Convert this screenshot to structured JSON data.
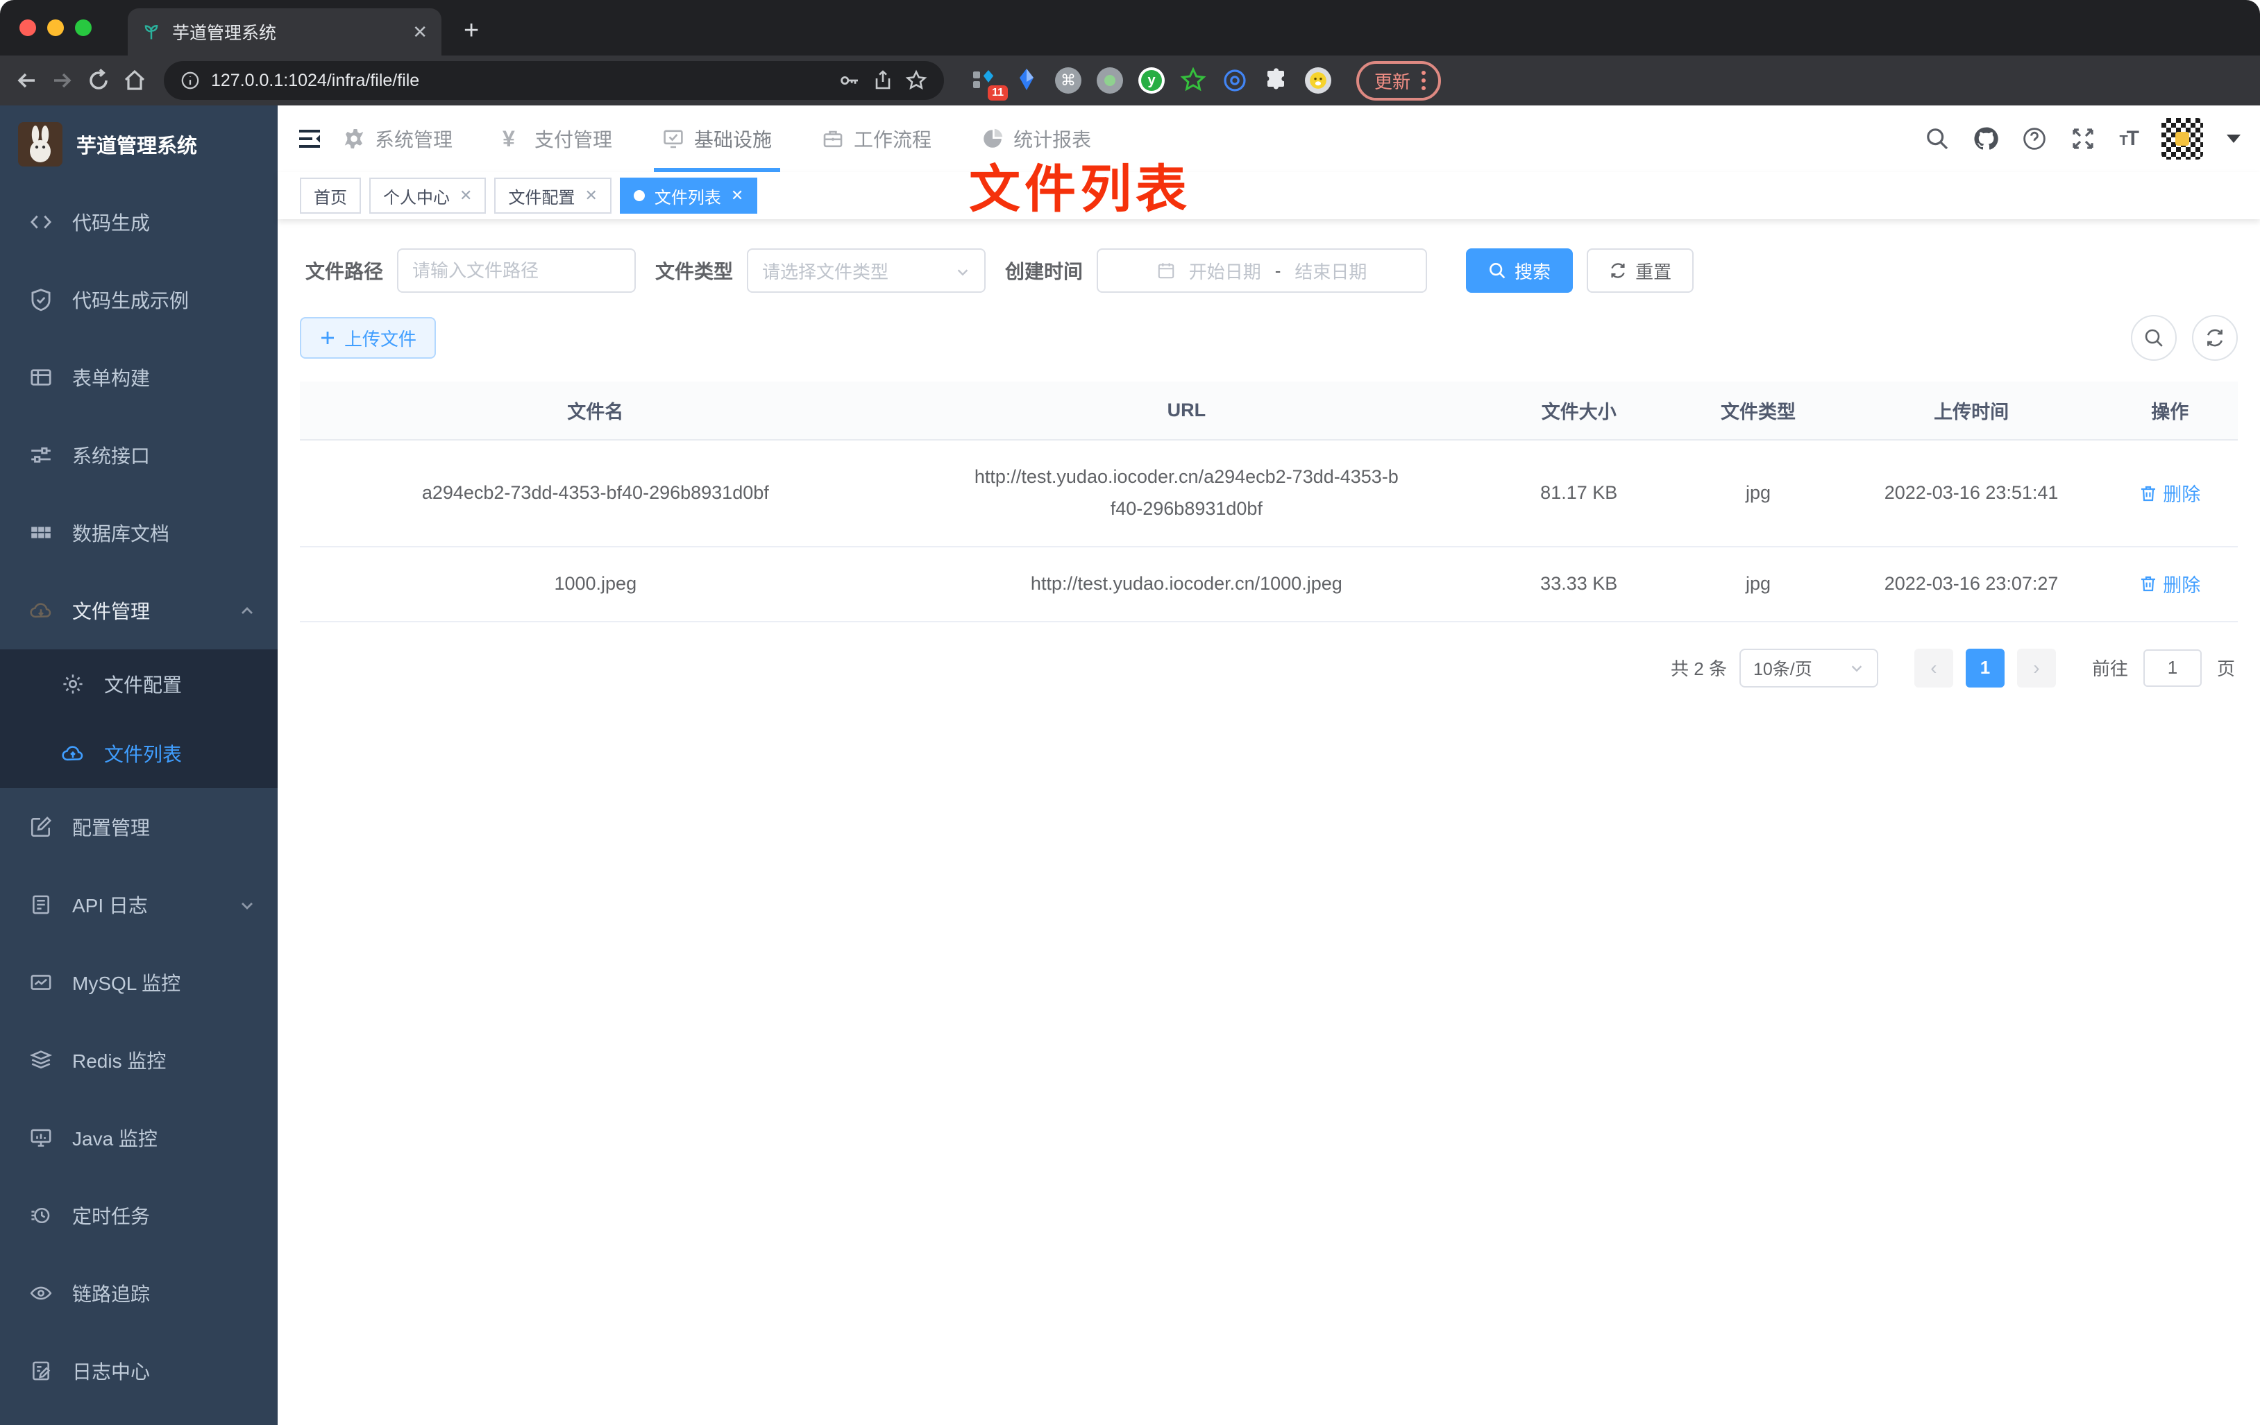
{
  "browser": {
    "tab_title": "芋道管理系统",
    "url": "127.0.0.1:1024/infra/file/file",
    "update_label": "更新",
    "extension_badge": "11"
  },
  "sidebar": {
    "title": "芋道管理系统",
    "items": [
      {
        "label": "代码生成"
      },
      {
        "label": "代码生成示例"
      },
      {
        "label": "表单构建"
      },
      {
        "label": "系统接口"
      },
      {
        "label": "数据库文档"
      },
      {
        "label": "文件管理"
      },
      {
        "label": "文件配置"
      },
      {
        "label": "文件列表"
      },
      {
        "label": "配置管理"
      },
      {
        "label": "API 日志"
      },
      {
        "label": "MySQL 监控"
      },
      {
        "label": "Redis 监控"
      },
      {
        "label": "Java 监控"
      },
      {
        "label": "定时任务"
      },
      {
        "label": "链路追踪"
      },
      {
        "label": "日志中心"
      }
    ]
  },
  "topnav": {
    "items": [
      {
        "label": "系统管理"
      },
      {
        "label": "支付管理"
      },
      {
        "label": "基础设施"
      },
      {
        "label": "工作流程"
      },
      {
        "label": "统计报表"
      }
    ]
  },
  "tags": [
    {
      "label": "首页"
    },
    {
      "label": "个人中心"
    },
    {
      "label": "文件配置"
    },
    {
      "label": "文件列表"
    }
  ],
  "annotation": {
    "text": "文件列表"
  },
  "filters": {
    "path_label": "文件路径",
    "path_placeholder": "请输入文件路径",
    "type_label": "文件类型",
    "type_placeholder": "请选择文件类型",
    "date_label": "创建时间",
    "date_start_placeholder": "开始日期",
    "date_separator": "-",
    "date_end_placeholder": "结束日期",
    "search_label": "搜索",
    "reset_label": "重置"
  },
  "toolbar": {
    "upload_label": "上传文件"
  },
  "table": {
    "columns": [
      "文件名",
      "URL",
      "文件大小",
      "文件类型",
      "上传时间",
      "操作"
    ],
    "rows": [
      {
        "name": "a294ecb2-73dd-4353-bf40-296b8931d0bf",
        "url": "http://test.yudao.iocoder.cn/a294ecb2-73dd-4353-bf40-296b8931d0bf",
        "size": "81.17 KB",
        "type": "jpg",
        "time": "2022-03-16 23:51:41",
        "action": "删除"
      },
      {
        "name": "1000.jpeg",
        "url": "http://test.yudao.iocoder.cn/1000.jpeg",
        "size": "33.33 KB",
        "type": "jpg",
        "time": "2022-03-16 23:07:27",
        "action": "删除"
      }
    ]
  },
  "pagination": {
    "total": "共 2 条",
    "per_page": "10条/页",
    "page": "1",
    "goto_label": "前往",
    "goto_value": "1",
    "page_unit": "页"
  },
  "colors": {
    "accent": "#409eff",
    "annotation_red": "#f5310b",
    "sidebar_bg": "#304156",
    "submenu_bg": "#212c3d"
  }
}
